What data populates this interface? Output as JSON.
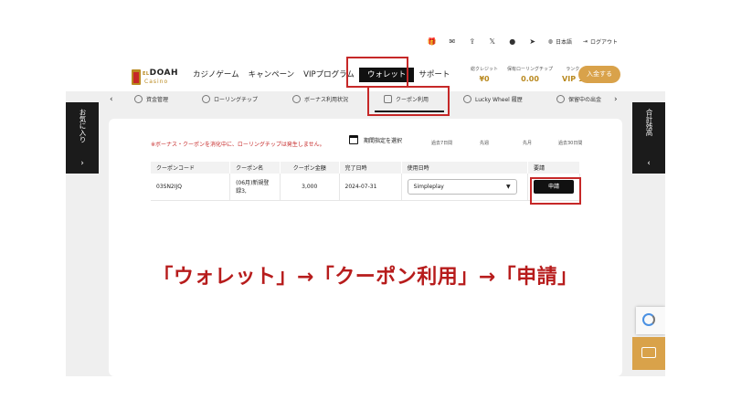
{
  "header": {
    "top_links": {
      "language": "日本語",
      "logout": "ログアウト"
    },
    "logo": {
      "name": "DOAH",
      "prefix": "EL",
      "sub": "Casino"
    },
    "nav": [
      {
        "label": "カジノゲーム"
      },
      {
        "label": "キャンペーン"
      },
      {
        "label": "VIPプログラム"
      },
      {
        "label": "ウォレット"
      },
      {
        "label": "サポート"
      }
    ],
    "stats": [
      {
        "label": "総クレジット",
        "value": "¥0"
      },
      {
        "label": "保有ローリングチップ",
        "value": "0.00"
      },
      {
        "label": "ランク",
        "value": "VIP 1"
      }
    ],
    "deposit_label": "入金する"
  },
  "subnav": {
    "items": [
      {
        "label": "資金管理"
      },
      {
        "label": "ローリングチップ"
      },
      {
        "label": "ボーナス利用状況"
      },
      {
        "label": "クーポン利用"
      },
      {
        "label": "Lucky Wheel 履歴"
      },
      {
        "label": "保留中の出金"
      }
    ]
  },
  "side_left": {
    "label": "お気に入り"
  },
  "side_right": {
    "label": "合計残高"
  },
  "panel": {
    "notice": "※ボーナス・クーポンを消化中に、ローリングチップは発生しません。",
    "period_label": "期間指定を選択",
    "ranges": [
      "過去7日間",
      "先週",
      "先月",
      "過去30日間"
    ],
    "table": {
      "headers": [
        "クーポンコード",
        "クーポン名",
        "クーポン金額",
        "完了日時",
        "使用日時",
        "要請"
      ],
      "rows": [
        {
          "code": "03SN2IJQ",
          "name": "(06月)新規登録3,",
          "amount": "3,000",
          "completed": "2024-07-31",
          "provider": "Simpleplay",
          "action": "申請"
        }
      ]
    }
  },
  "overlay_text": "「ウォレット」→「クーポン利用」→「申請」",
  "colors": {
    "accent_red": "#c62828",
    "gold": "#d9a24a",
    "dark": "#111111"
  }
}
